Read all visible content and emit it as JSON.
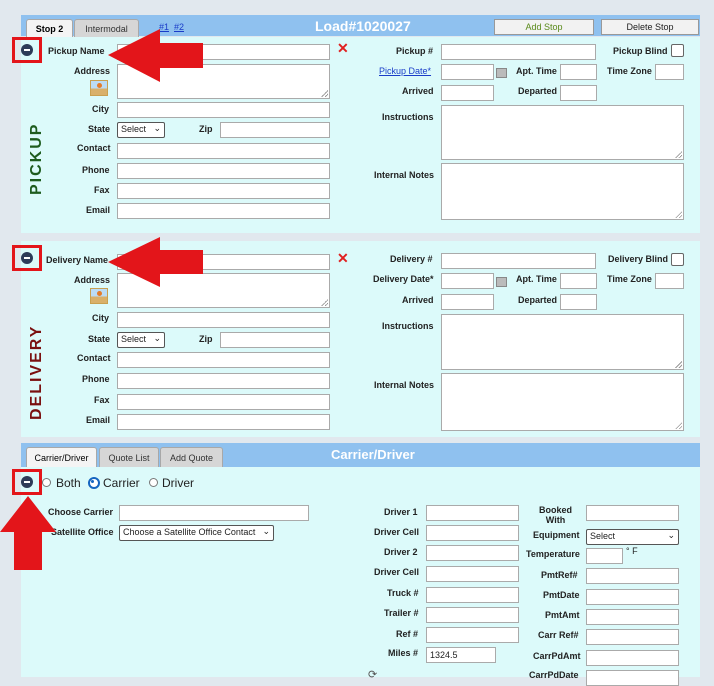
{
  "load_header": {
    "tabs": [
      "Stop 2",
      "Intermodal"
    ],
    "stop_links": [
      "#1",
      "#2"
    ],
    "title": "Load#1020027",
    "add_stop": "Add Stop",
    "delete_stop": "Delete Stop"
  },
  "pickup": {
    "side_label": "PICKUP",
    "labels": {
      "name": "Pickup Name",
      "address": "Address",
      "city": "City",
      "state": "State",
      "zip": "Zip",
      "contact": "Contact",
      "phone": "Phone",
      "fax": "Fax",
      "email": "Email",
      "number": "Pickup #",
      "blind": "Pickup Blind",
      "date": "Pickup Date*",
      "apt_time": "Apt. Time",
      "time_zone": "Time Zone",
      "arrived": "Arrived",
      "departed": "Departed",
      "instructions": "Instructions",
      "internal_notes": "Internal Notes"
    },
    "state_value": "Select"
  },
  "delivery": {
    "side_label": "DELIVERY",
    "labels": {
      "name": "Delivery Name",
      "address": "Address",
      "city": "City",
      "state": "State",
      "zip": "Zip",
      "contact": "Contact",
      "phone": "Phone",
      "fax": "Fax",
      "email": "Email",
      "number": "Delivery #",
      "blind": "Delivery Blind",
      "date": "Delivery Date*",
      "apt_time": "Apt. Time",
      "time_zone": "Time Zone",
      "arrived": "Arrived",
      "departed": "Departed",
      "instructions": "Instructions",
      "internal_notes": "Internal Notes"
    },
    "state_value": "Select"
  },
  "carrier": {
    "tabs": [
      "Carrier/Driver",
      "Quote List",
      "Add Quote"
    ],
    "title": "Carrier/Driver",
    "radios": [
      "Both",
      "Carrier",
      "Driver"
    ],
    "selected_radio": "Carrier",
    "labels": {
      "choose_carrier": "Choose Carrier",
      "satellite_office": "Satellite Office",
      "driver1": "Driver 1",
      "driver_cell1": "Driver Cell",
      "driver2": "Driver 2",
      "driver_cell2": "Driver Cell",
      "truck": "Truck #",
      "trailer": "Trailer #",
      "ref": "Ref #",
      "miles": "Miles #",
      "booked_with": "Booked With",
      "equipment": "Equipment",
      "temperature": "Temperature",
      "temp_unit": "°  F",
      "pmt_ref": "PmtRef#",
      "pmt_date": "PmtDate",
      "pmt_amt": "PmtAmt",
      "carr_ref": "Carr Ref#",
      "carr_pd_amt": "CarrPdAmt",
      "carr_pd_date": "CarrPdDate"
    },
    "satellite_value": "Choose a Satellite Office Contact",
    "equipment_value": "Select",
    "miles_value": "1324.5"
  },
  "colors": {
    "header_blue": "#8fc1ef",
    "panel_bg": "#dcfafa",
    "annotation_red": "#e3151a",
    "pickup_label": "#1e5c1e",
    "delivery_label": "#7a1010"
  }
}
